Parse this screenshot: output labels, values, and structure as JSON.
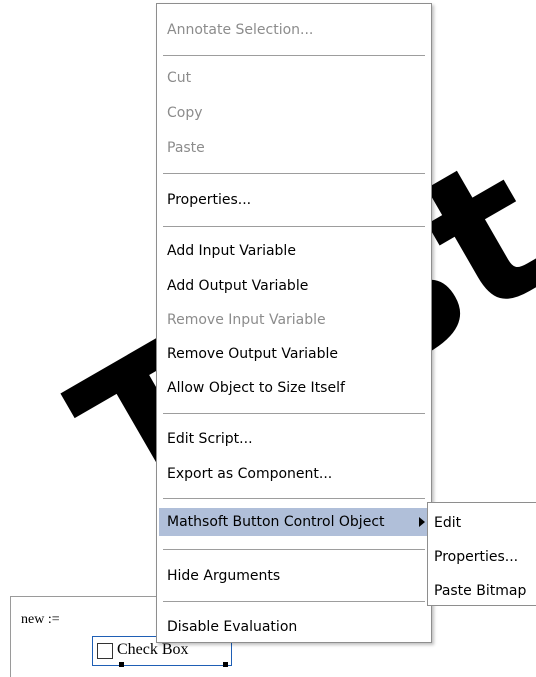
{
  "worksheet": {
    "expression": "new :=",
    "checkbox_label": "Check Box"
  },
  "context_menu": {
    "items": [
      {
        "label": "Annotate Selection...",
        "enabled": false
      },
      {
        "label": "Cut",
        "enabled": false
      },
      {
        "label": "Copy",
        "enabled": false
      },
      {
        "label": "Paste",
        "enabled": false
      },
      {
        "label": "Properties...",
        "enabled": true
      },
      {
        "label": "Add Input Variable",
        "enabled": true
      },
      {
        "label": "Add Output Variable",
        "enabled": true
      },
      {
        "label": "Remove Input Variable",
        "enabled": false
      },
      {
        "label": "Remove Output Variable",
        "enabled": true
      },
      {
        "label": "Allow Object to Size Itself",
        "enabled": true
      },
      {
        "label": "Edit Script...",
        "enabled": true
      },
      {
        "label": "Export as Component...",
        "enabled": true
      },
      {
        "label": "Mathsoft Button Control Object",
        "enabled": true,
        "highlighted": true,
        "has_submenu": true
      },
      {
        "label": "Hide Arguments",
        "enabled": true
      },
      {
        "label": "Disable Evaluation",
        "enabled": true
      }
    ]
  },
  "submenu": {
    "items": [
      {
        "label": "Edit"
      },
      {
        "label": "Properties..."
      },
      {
        "label": "Paste Bitmap"
      }
    ]
  },
  "watermark": {
    "text": "Trist"
  },
  "colors": {
    "highlight": "#b0bfd9",
    "disabled_text": "#8c8c8c",
    "selection_border": "#1f5fb5"
  }
}
